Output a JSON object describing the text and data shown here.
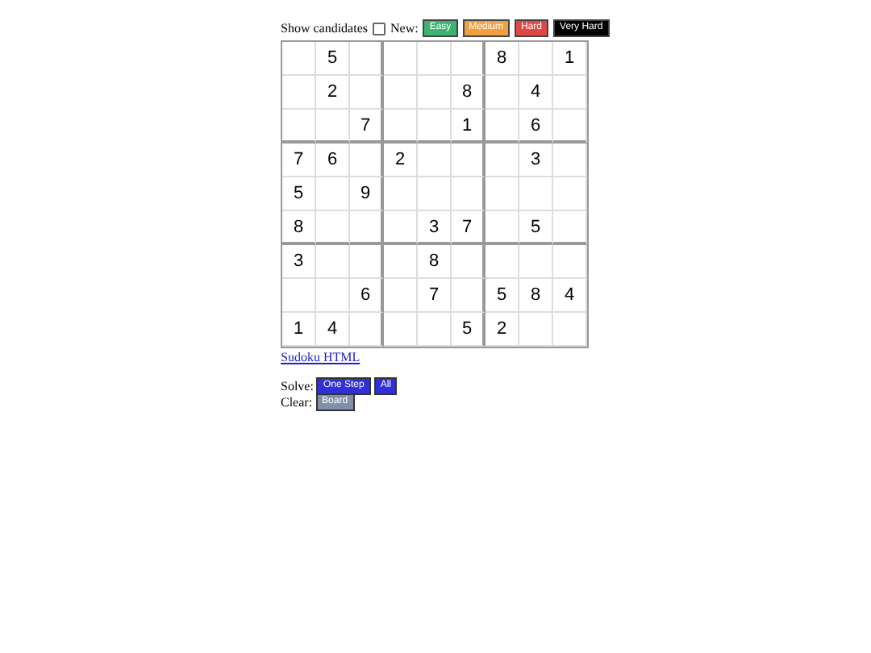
{
  "toolbar": {
    "show_candidates": {
      "label": "Show candidates",
      "checked": false
    },
    "new_label": "New:",
    "levels": [
      {
        "label": "Easy",
        "color": "#3cb371"
      },
      {
        "label": "Medium",
        "color": "#f0a040"
      },
      {
        "label": "Hard",
        "color": "#e04848"
      },
      {
        "label": "Very Hard",
        "color": "#000000"
      }
    ]
  },
  "grid": [
    {
      "col_2": "5",
      "col_7": "8",
      "col_9": "1"
    },
    {
      "col_2": "2",
      "col_6": "8",
      "col_8": "4"
    },
    {
      "col_3": "7",
      "col_6": "1",
      "col_8": "6"
    },
    {
      "col_1": "7",
      "col_2": "6",
      "col_4": "2",
      "col_8": "3"
    },
    {
      "col_1": "5",
      "col_3": "9"
    },
    {
      "col_1": "8",
      "col_5": "3",
      "col_6": "7",
      "col_8": "5"
    },
    {
      "col_1": "3",
      "col_5": "8"
    },
    {
      "col_3": "6",
      "col_5": "7",
      "col_7": "5",
      "col_8": "8",
      "col_9": "4"
    },
    {
      "col_1": "1",
      "col_2": "4",
      "col_6": "5",
      "col_7": "2"
    }
  ],
  "link": "Sudoku HTML",
  "actions": [
    {
      "label": "Solve:",
      "buttons": [
        {
          "label": "One Step",
          "color": "#3030d8"
        },
        {
          "label": "All",
          "color": "#3030d8"
        }
      ]
    },
    {
      "label": "Clear:",
      "buttons": [
        {
          "label": "Board",
          "color": "#8090a8"
        }
      ]
    }
  ]
}
